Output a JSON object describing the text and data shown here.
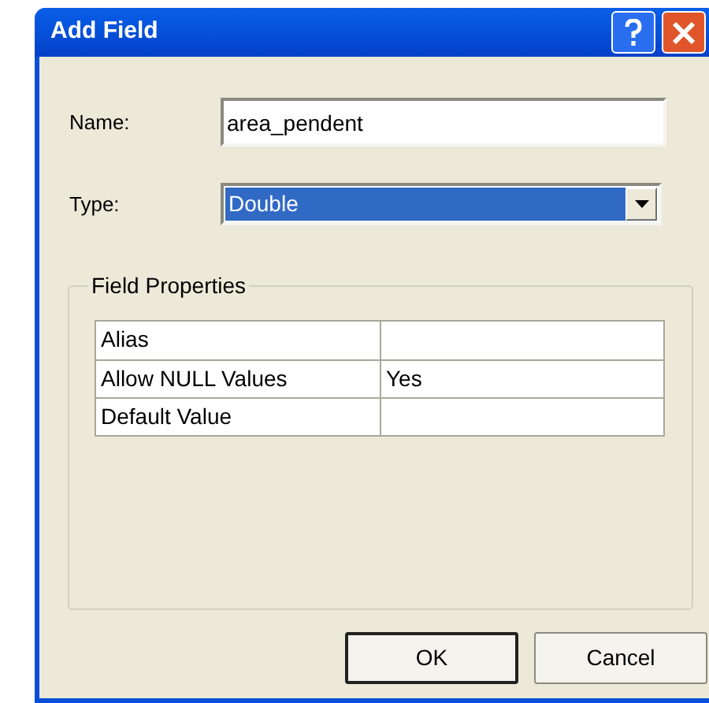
{
  "window": {
    "title": "Add Field"
  },
  "name_field": {
    "label": "Name:",
    "value": "area_pendent"
  },
  "type_field": {
    "label": "Type:",
    "value": "Double",
    "highlighted": true
  },
  "field_properties": {
    "title": "Field Properties",
    "rows": [
      {
        "property": "Alias"
      },
      {
        "property": "Allow NULL Values",
        "value": "Yes"
      },
      {
        "property": "Default Value"
      }
    ]
  },
  "buttons": [
    {
      "label": "OK",
      "default": true
    },
    {
      "label": "Cancel",
      "default": false
    }
  ]
}
